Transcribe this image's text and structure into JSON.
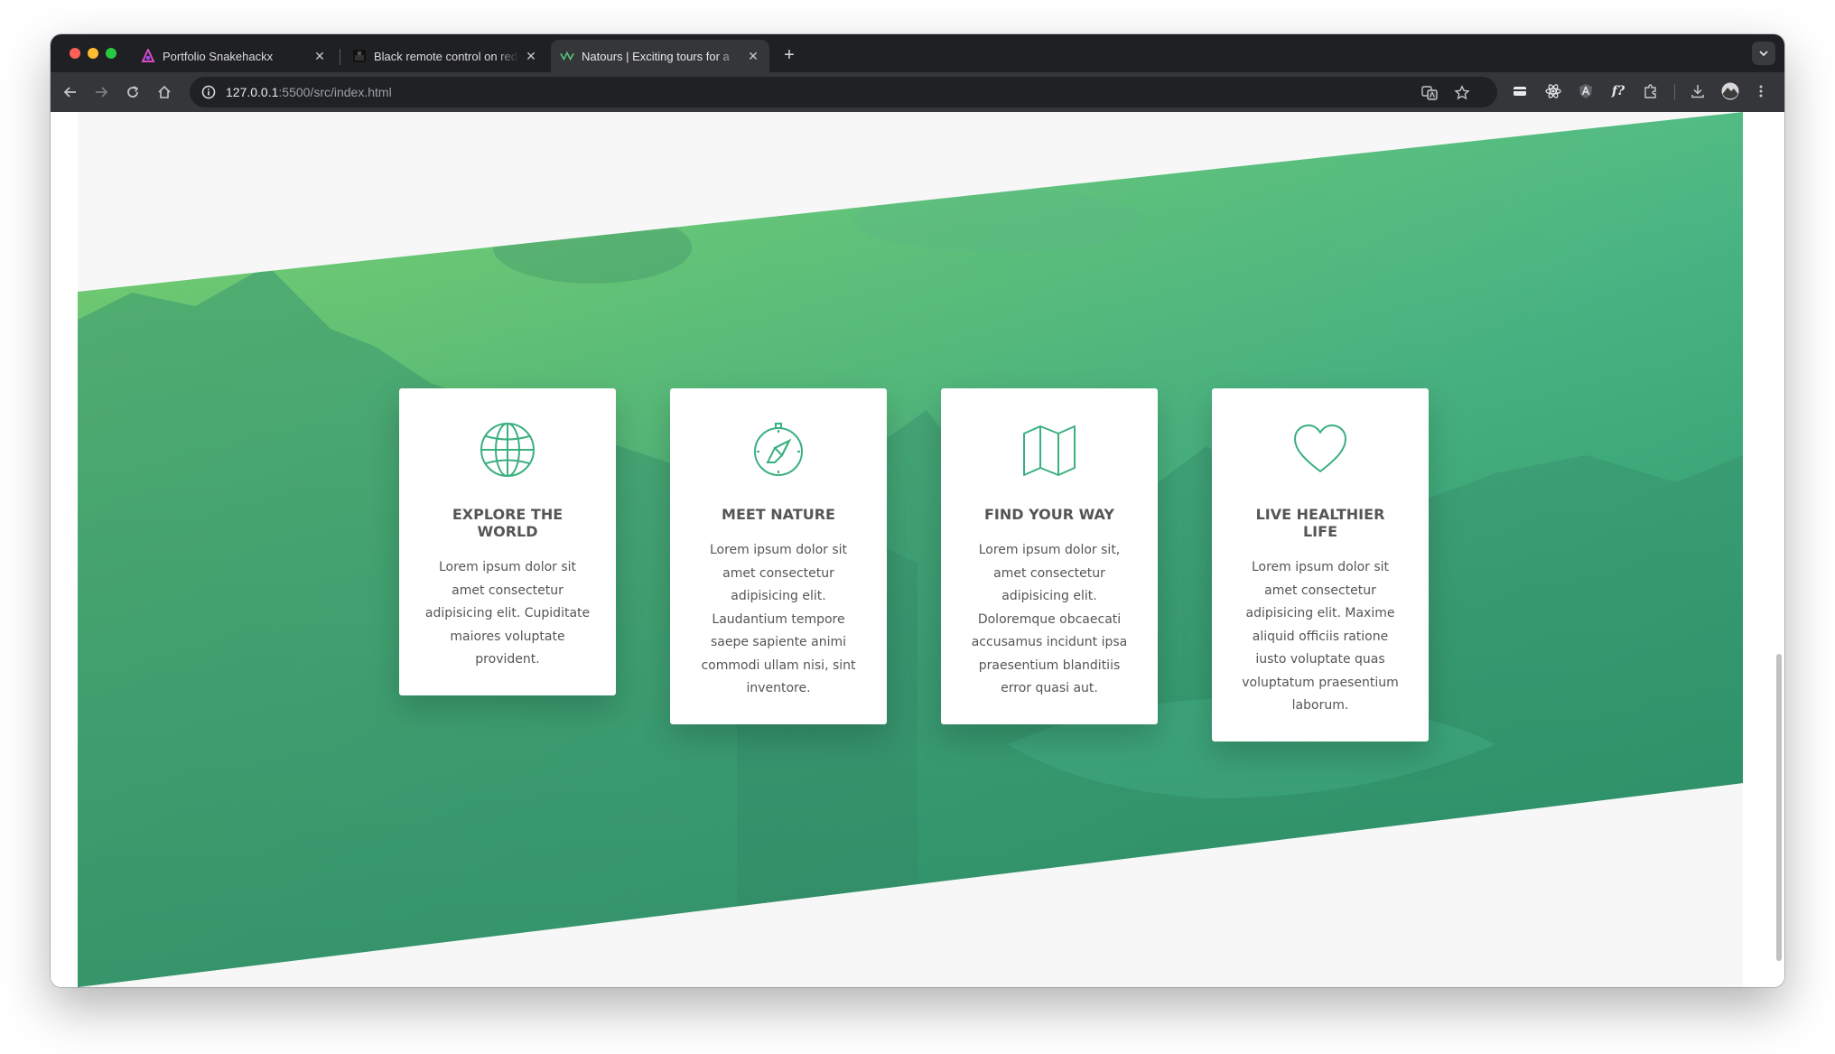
{
  "browser": {
    "tabs": [
      {
        "title": "Portfolio Snakehackx",
        "favicon": "snakehackx-logo-icon",
        "active": false
      },
      {
        "title": "Black remote control on red t",
        "favicon": "image-thumbnail-icon",
        "active": false
      },
      {
        "title": "Natours | Exciting tours for a",
        "favicon": "natours-logo-icon",
        "active": true
      }
    ],
    "url_host": "127.0.0.1",
    "url_rest": ":5500/src/index.html"
  },
  "features": [
    {
      "icon": "globe-icon",
      "heading": "Explore the world",
      "text": "Lorem ipsum dolor sit amet consectetur adipisicing elit. Cupiditate maiores voluptate provident."
    },
    {
      "icon": "compass-icon",
      "heading": "Meet nature",
      "text": "Lorem ipsum dolor sit amet consectetur adipisicing elit. Laudantium tempore saepe sapiente animi commodi ullam nisi, sint inventore."
    },
    {
      "icon": "map-icon",
      "heading": "Find your way",
      "text": "Lorem ipsum dolor sit, amet consectetur adipisicing elit. Doloremque obcaecati accusamus incidunt ipsa praesentium blanditiis error quasi aut."
    },
    {
      "icon": "heart-icon",
      "heading": "Live healthier life",
      "text": "Lorem ipsum dolor sit amet consectetur adipisicing elit. Maxime aliquid officiis ratione iusto voluptate quas voluptatum praesentium laborum."
    }
  ],
  "colors": {
    "primary_light": "#7ed56f",
    "primary_dark": "#28b485",
    "icon_green": "#3bb07f",
    "text_grey": "#555555"
  }
}
